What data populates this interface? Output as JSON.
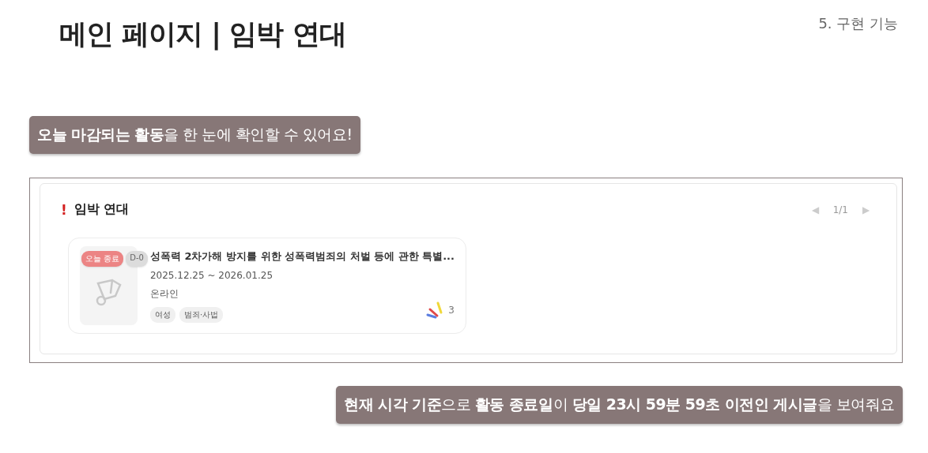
{
  "header": {
    "title": "메인 페이지 | 임박 연대",
    "section": "5. 구현 기능"
  },
  "callout_top": "**오늘 마감되는 활동**을 한 눈에 확인할 수 있어요!",
  "panel": {
    "title": "임박 연대",
    "alert_mark": "!",
    "pager": {
      "prev": {
        "label": "◀",
        "disabled": true
      },
      "page": "1/1",
      "next": {
        "label": "▶",
        "disabled": true
      }
    },
    "cards": [
      {
        "badges": [
          {
            "label": "오늘 종료",
            "kind": "today"
          },
          {
            "label": "D-0",
            "kind": "dday"
          }
        ],
        "title": "성폭력 2차가해 방지를 위한 성폭력범죄의 처벌 등에 관한 특별...",
        "period": "2025.12.25 ~ 2026.01.25",
        "location": "온라인",
        "tags": [
          "여성",
          "범죄·사법"
        ],
        "count": "3"
      }
    ]
  },
  "callout_bottom": "**현재 시각 기준**으로 **활동 종료일**이 **당일 23시 59분 59초 이전인 게시글**을 보여줘요"
}
